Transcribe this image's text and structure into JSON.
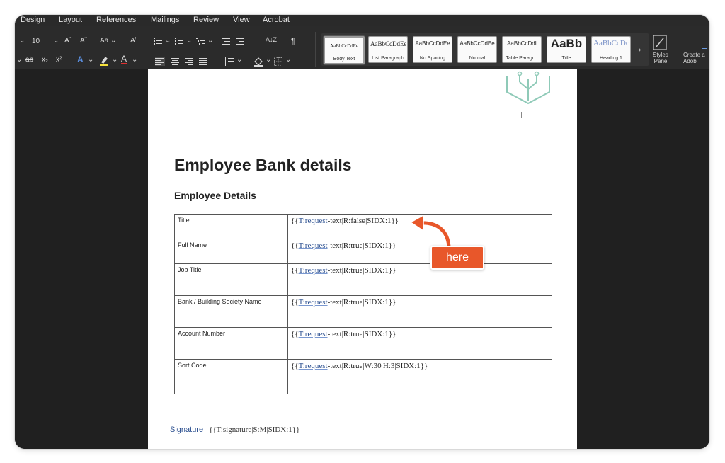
{
  "menu": [
    "Design",
    "Layout",
    "References",
    "Mailings",
    "Review",
    "View",
    "Acrobat"
  ],
  "ribbon": {
    "font_size": "10",
    "font_controls": [
      "Aˆ",
      "Aˇ",
      "Aa ⌄",
      "A̸"
    ],
    "format_controls": [
      "ab",
      "x₂",
      "x²"
    ],
    "paragraph_mark": "¶",
    "sort_label": "A↓Z",
    "styles": [
      {
        "preview": "AaBbCcDdEe",
        "name": "Body Text",
        "selected": true
      },
      {
        "preview": "AaBbCcDdEe",
        "name": "List Paragraph"
      },
      {
        "preview": "AaBbCcDdEe",
        "name": "No Spacing"
      },
      {
        "preview": "AaBbCcDdEe",
        "name": "Normal"
      },
      {
        "preview": "AaBbCcDdI",
        "name": "Table Paragr..."
      },
      {
        "preview": "AaBb",
        "name": "Title"
      },
      {
        "preview": "AaBbCcDc",
        "name": "Heading 1"
      }
    ],
    "styles_pane_label": "Styles Pane",
    "create_label": "Create a Adob"
  },
  "document": {
    "title": "Employee Bank details",
    "subtitle": "Employee Details",
    "rows": [
      {
        "label": "Title",
        "tag": "T:request",
        "rest": "-text|R:false|SIDX:1}}"
      },
      {
        "label": "Full Name",
        "tag": "T:request",
        "rest": "-text|R:true|SIDX:1}}"
      },
      {
        "label": "Job Title",
        "tag": "T:request",
        "rest": "-text|R:true|SIDX:1}}"
      },
      {
        "label": "Bank / Building Society Name",
        "tag": "T:request",
        "rest": "-text|R:true|SIDX:1}}"
      },
      {
        "label": "Account Number",
        "tag": "T:request",
        "rest": "-text|R:true|SIDX:1}}"
      },
      {
        "label": "Sort Code",
        "tag": "T:request",
        "rest": "-text|R:true|W:30|H:3|SIDX:1}}"
      }
    ],
    "signature_label": "Signature",
    "signature_field": "{{T:signature|S:M|SIDX:1}}"
  },
  "annotation": {
    "text": "here",
    "color": "#e8572a"
  }
}
